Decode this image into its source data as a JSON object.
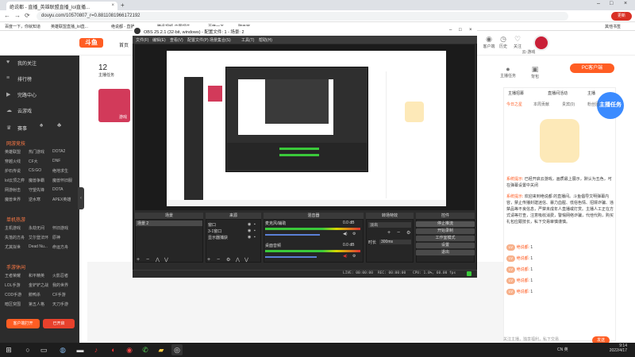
{
  "browser": {
    "tab_title": "绝说都 - 直播_英雄联盟直播_lol直播...",
    "tab_close": "×",
    "new_tab": "+",
    "url": "douyu.com/10570807_r=0.8811081966172192",
    "update_label": "更新",
    "bookmarks": [
      "百度一下，你就知道",
      "英雄联盟直播_lol直...",
      "绝说都 - 直播...",
      "腾讯视频-中国领先...",
      "百度一下",
      "聊天室"
    ],
    "bookmark_right": "其他书签",
    "nav": {
      "back": "←",
      "forward": "→",
      "reload": "⟳"
    },
    "window_controls": {
      "min": "–",
      "max": "□",
      "close": "×"
    }
  },
  "site": {
    "logo": "斗鱼",
    "head_icons": [
      {
        "icon": "bell-icon",
        "label": "客户端"
      },
      {
        "icon": "history-icon",
        "label": "历史"
      },
      {
        "icon": "heart-icon",
        "label": "关注"
      },
      {
        "icon": "chat-icon",
        "label": "云-游戏"
      }
    ],
    "main_label": "首页",
    "stats": [
      {
        "num": "12",
        "label": "主播任务"
      }
    ],
    "thumb_label": "游戏",
    "pc_btn": "PC客户端",
    "right_icons": [
      {
        "icon": "anchor-icon",
        "label": "主播任务"
      },
      {
        "icon": "bag-icon",
        "label": "背包"
      }
    ]
  },
  "sidebar": {
    "items": [
      {
        "icon": "heart-icon",
        "label": "我的关注"
      },
      {
        "icon": "rank-icon",
        "label": "排行榜"
      },
      {
        "icon": "video-icon",
        "label": "完路中心"
      },
      {
        "icon": "cloud-icon",
        "label": "云游戏"
      }
    ],
    "shortcuts": [
      "赛事",
      "",
      ""
    ],
    "sections": [
      {
        "title": "网游竞技",
        "games": [
          "英雄联盟",
          "热门游戏",
          "DOTA2",
          "穿越火线",
          "CF大",
          "DNF",
          "炉石传说",
          "CS:GO",
          "绝地求生",
          "lol云顶之弈",
          "魔兽争霸",
          "魔兽怀旧服",
          "网游射击",
          "守望先锋",
          "DOTA",
          "魔兽世界",
          "逆水寒",
          "APEX英雄"
        ]
      },
      {
        "title": "单机热游",
        "games": [
          "主机游戏",
          "永劫无间",
          "怀旧游戏",
          "失落的方舟",
          "艾尔登法环",
          "原神",
          "尤其拟世",
          "Dead Nu...",
          "命运方舟"
        ]
      },
      {
        "title": "手游休闲",
        "games": [
          "王者荣耀",
          "和平精英",
          "火影忍者",
          "LOL手游",
          "金铲铲之战",
          "我的世界",
          "COD手游",
          "鹅鸭杀",
          "CF手游",
          "暗区突围",
          "第五人格",
          "天刀手游"
        ]
      }
    ],
    "btn_left": "客户端打开",
    "btn_right": "已开启"
  },
  "right_panel": {
    "top_left": "主播招募",
    "top_mid": "直播间活动",
    "top_right": "主播",
    "tabs": [
      "今日之星",
      "本周贡献",
      "贵宾(0)",
      "粉丝团"
    ],
    "badge": "主播任务",
    "messages": [
      {
        "tag": "系统提示:",
        "text": "已经开启云游戏，画质最上展示，默认为五色，可在弹幕设置中关闭"
      },
      {
        "tag": "系统提示:",
        "text": "欢迎来到绝说都 的直播间。斗鱼倡导文明弹幕内容，禁止传播封建迷信、暴力血腥、低俗色情、招嫖诈骗、违禁品等不良信息，严禁未成年人直播或打赏。主播人工正在方式请等打查，注意吸收消费，警惕网络诈骗，代他代购，购买礼包应跟技长，私下交易审慎谨慎。"
      },
      {
        "tag": "绝说都:",
        "text": "1"
      },
      {
        "tag": "绝说都:",
        "text": "1"
      },
      {
        "tag": "绝说都:",
        "text": "1"
      },
      {
        "tag": "绝说都:",
        "text": "1"
      },
      {
        "tag": "绝说都:",
        "text": "1"
      }
    ],
    "input_placeholder": "关注主播，独享福利，私下交易",
    "send": "发送"
  },
  "obs": {
    "title": "OBS 25.2.1 (32-bit, windows) - 配置文件: 1 - 场景: 2",
    "menu": [
      "文件(F)",
      "编辑(E)",
      "查看(V)",
      "配置文件(P)",
      "场景集合(S)",
      "工具(T)",
      "帮助(H)"
    ],
    "docks": {
      "scenes": {
        "title": "场景",
        "items": [
          "场景 2"
        ]
      },
      "sources": {
        "title": "来源",
        "items": [
          "窗口",
          "3-1窗口",
          "显示器捕获"
        ]
      },
      "mixer": {
        "title": "混音器",
        "channels": [
          {
            "name": "麦克风/辅助",
            "db": "0.0 dB",
            "level": 0.72
          },
          {
            "name": "桌面音频",
            "db": "0.0 dB",
            "level": 0.68
          }
        ]
      },
      "transitions": {
        "title": "转场特效",
        "type": "淡出",
        "duration_label": "时长",
        "duration": "300ms"
      },
      "controls": {
        "title": "控件",
        "buttons": [
          "停止推流",
          "开始录制",
          "工作室模式",
          "设置",
          "退出"
        ]
      }
    },
    "status": {
      "live": "LIVE: 00:00:00",
      "rec": "REC: 00:00:00",
      "cpu": "CPU: 1.0%, 60.00 fps"
    }
  },
  "taskbar": {
    "icons": [
      "windows-icon",
      "search-icon",
      "taskview-icon",
      "steam-icon",
      "app-icon",
      "netease-icon",
      "browser-icon",
      "chrome-icon",
      "wechat-icon",
      "folder-icon",
      "obs-icon"
    ],
    "tray_text": "CN 英",
    "time": "9:14",
    "date": "2022/4/17"
  }
}
